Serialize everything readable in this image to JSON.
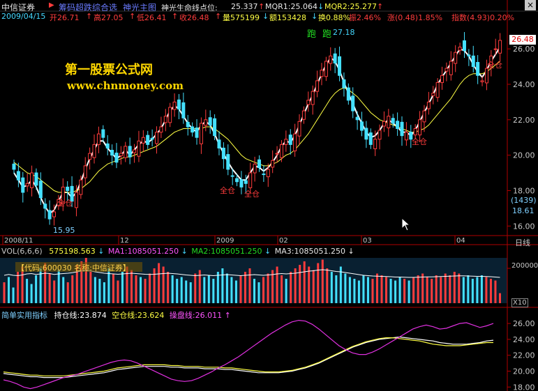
{
  "header": {
    "broker": "中信证券",
    "indicator_group": "筹码超跌综合选",
    "main_chart_name": "神光主图",
    "status_label": "神光生命线点位:",
    "status_value": "25.337",
    "mqr1": "MQR1:25.064",
    "mqr2": "MQR2:25.277",
    "arrow_up": "↑",
    "arrow_down": "↓",
    "close_glyph": "×"
  },
  "quote": {
    "date": "2009/04/15",
    "open": "开26.71",
    "high": "高27.05",
    "low": "低26.41",
    "close": "收26.48",
    "volume": "量575199",
    "amount": "额153428",
    "turnover": "换0.88%",
    "amplitude": "振2.46%",
    "change": "涨(0.48)1.85%",
    "index": "指数(4.93)0.20%"
  },
  "watermark": {
    "title": "第一股票公式网",
    "url": "www.chnmoney.com"
  },
  "annotations": {
    "run_label": "跑",
    "run_price": "27.18",
    "full_pos": "全仓",
    "low_price": "15.95",
    "price_tag": "26.48",
    "right_count": "(1439)",
    "right_price": "18.61",
    "period": "日线"
  },
  "vol_panel": {
    "title": "VOL(6,6,6)",
    "value": "575198.563",
    "ma1": "MA1:1085051.250",
    "ma2": "MA2:1085051.250",
    "ma3": "MA3:1085051.250",
    "badge": "【代码:600030 名称:中信证券】",
    "axis_label": "200000",
    "unit": "X10"
  },
  "indicator_panel": {
    "title": "简单实用指标",
    "hold_line": "持仓线:23.874",
    "empty_line": "空仓线:23.624",
    "operate_line": "操盘线:26.011"
  },
  "colors": {
    "up": "#ff3c3c",
    "down": "#44e0ff",
    "ma_yellow": "#ffff44",
    "line_white": "#ffffff",
    "line_magenta": "#e030e0",
    "axis": "#b00000",
    "background": "#000000"
  },
  "chart_data": [
    {
      "type": "candlestick",
      "title": "神光主图",
      "x_tick_labels": [
        "2008/11",
        "12",
        "2009",
        "02",
        "03",
        "04"
      ],
      "y_ticks": [
        16.0,
        18.0,
        20.0,
        22.0,
        24.0,
        26.0
      ],
      "ylim": [
        15.5,
        27.5
      ],
      "close": [
        19.2,
        18.6,
        17.9,
        18.4,
        19.0,
        18.3,
        17.6,
        17.0,
        16.4,
        16.8,
        17.5,
        18.2,
        18.0,
        17.4,
        17.9,
        18.6,
        19.4,
        20.1,
        20.6,
        21.2,
        21.0,
        20.4,
        20.0,
        19.6,
        20.1,
        20.5,
        19.9,
        20.3,
        20.8,
        21.0,
        20.6,
        20.9,
        21.3,
        21.6,
        22.2,
        22.7,
        23.0,
        22.6,
        22.1,
        21.6,
        21.3,
        21.0,
        21.8,
        22.0,
        21.7,
        21.1,
        20.4,
        19.8,
        19.2,
        18.8,
        18.5,
        18.2,
        18.4,
        19.0,
        19.5,
        19.3,
        18.9,
        19.2,
        19.7,
        20.1,
        20.6,
        20.9,
        20.6,
        21.2,
        21.9,
        22.5,
        23.1,
        23.6,
        24.2,
        24.8,
        25.3,
        25.6,
        25.2,
        24.5,
        23.8,
        23.1,
        22.5,
        22.0,
        21.4,
        20.9,
        20.6,
        20.9,
        21.4,
        21.9,
        22.2,
        21.8,
        21.5,
        21.1,
        21.3,
        20.9,
        21.5,
        22.0,
        22.5,
        23.0,
        23.5,
        24.1,
        24.5,
        24.9,
        25.3,
        25.8,
        26.1,
        25.9,
        25.6,
        25.0,
        24.5,
        24.2,
        24.9,
        25.6,
        26.0,
        26.48
      ],
      "series": [
        {
          "name": "",
          "color": "#ffffff",
          "values": [
            19.0,
            18.6,
            18.2,
            18.3,
            18.6,
            18.2,
            17.6,
            17.1,
            16.7,
            16.9,
            17.4,
            17.9,
            17.9,
            17.6,
            17.9,
            18.5,
            19.2,
            19.8,
            20.3,
            20.8,
            20.8,
            20.4,
            20.1,
            19.8,
            20.0,
            20.3,
            20.0,
            20.3,
            20.6,
            20.8,
            20.7,
            20.9,
            21.2,
            21.5,
            22.0,
            22.5,
            22.8,
            22.6,
            22.2,
            21.8,
            21.5,
            21.3,
            21.7,
            21.9,
            21.7,
            21.2,
            20.6,
            20.1,
            19.6,
            19.2,
            18.9,
            18.6,
            18.6,
            19.0,
            19.4,
            19.3,
            19.1,
            19.3,
            19.6,
            20.0,
            20.5,
            20.8,
            20.7,
            21.1,
            21.7,
            22.3,
            22.9,
            23.4,
            24.0,
            24.6,
            25.1,
            25.5,
            25.3,
            24.8,
            24.1,
            23.5,
            22.9,
            22.3,
            21.8,
            21.3,
            21.0,
            21.1,
            21.4,
            21.8,
            22.0,
            21.8,
            21.6,
            21.3,
            21.3,
            21.1,
            21.4,
            21.9,
            22.4,
            22.9,
            23.4,
            24.0,
            24.4,
            24.8,
            25.2,
            25.6,
            26.0,
            25.9,
            25.6,
            25.1,
            24.7,
            24.4,
            24.8,
            25.3,
            25.7,
            26.1
          ]
        },
        {
          "name": "",
          "color": "#ffff44",
          "values": [
            19.6,
            19.4,
            19.2,
            19.0,
            18.9,
            18.8,
            18.6,
            18.4,
            18.2,
            18.0,
            17.9,
            17.9,
            17.9,
            17.9,
            18.0,
            18.1,
            18.3,
            18.5,
            18.8,
            19.1,
            19.3,
            19.5,
            19.6,
            19.7,
            19.8,
            19.9,
            19.9,
            20.0,
            20.1,
            20.2,
            20.3,
            20.4,
            20.5,
            20.7,
            20.9,
            21.1,
            21.3,
            21.4,
            21.5,
            21.5,
            21.5,
            21.5,
            21.5,
            21.6,
            21.6,
            21.5,
            21.3,
            21.1,
            20.9,
            20.6,
            20.3,
            20.0,
            19.8,
            19.7,
            19.6,
            19.5,
            19.4,
            19.4,
            19.5,
            19.6,
            19.8,
            20.0,
            20.1,
            20.3,
            20.6,
            20.9,
            21.2,
            21.6,
            22.0,
            22.4,
            22.8,
            23.2,
            23.5,
            23.7,
            23.8,
            23.7,
            23.5,
            23.3,
            23.0,
            22.7,
            22.4,
            22.2,
            22.0,
            21.9,
            21.8,
            21.7,
            21.6,
            21.5,
            21.4,
            21.3,
            21.3,
            21.4,
            21.5,
            21.7,
            22.0,
            22.3,
            22.6,
            22.9,
            23.2,
            23.6,
            24.0,
            24.3,
            24.5,
            24.6,
            24.6,
            24.6,
            24.7,
            24.9,
            25.1,
            25.3
          ]
        }
      ],
      "annotations": [
        "跑 27.18",
        "全仓",
        "15.95"
      ]
    },
    {
      "type": "bar",
      "title": "VOL(6,6,6)",
      "y_ticks": [
        200000
      ],
      "unit": "X10",
      "values": [
        120000,
        150000,
        90000,
        180000,
        210000,
        140000,
        110000,
        160000,
        200000,
        230000,
        170000,
        130000,
        190000,
        150000,
        120000,
        160000,
        220000,
        240000,
        260000,
        180000,
        150000,
        140000,
        120000,
        200000,
        170000,
        130000,
        180000,
        210000,
        190000,
        160000,
        150000,
        140000,
        170000,
        200000,
        230000,
        210000,
        180000,
        160000,
        140000,
        150000,
        130000,
        120000,
        170000,
        190000,
        150000,
        160000,
        140000,
        180000,
        200000,
        170000,
        150000,
        130000,
        160000,
        180000,
        200000,
        140000,
        120000,
        150000,
        170000,
        190000,
        210000,
        160000,
        140000,
        180000,
        200000,
        220000,
        240000,
        210000,
        190000,
        230000,
        250000,
        200000,
        180000,
        160000,
        210000,
        170000,
        150000,
        140000,
        130000,
        160000,
        150000,
        140000,
        170000,
        160000,
        150000,
        140000,
        130000,
        150000,
        140000,
        130000,
        150000,
        160000,
        170000,
        150000,
        140000,
        160000,
        150000,
        170000,
        160000,
        180000,
        170000,
        150000,
        160000,
        140000,
        150000,
        160000,
        150000,
        140000,
        130000,
        57520
      ],
      "ma_line": [
        160000,
        165000,
        160000,
        158000,
        162000,
        168000,
        170000,
        165000,
        168000,
        172000,
        170000,
        165000,
        168000,
        170000,
        172000,
        175000,
        180000,
        185000,
        188000,
        185000,
        180000,
        176000,
        172000,
        170000,
        168000,
        166000,
        168000,
        170000,
        172000,
        170000,
        168000,
        166000,
        165000,
        166000,
        168000,
        170000,
        172000,
        170000,
        168000,
        165000,
        162000,
        160000,
        158000,
        160000,
        162000,
        160000,
        158000,
        160000,
        162000,
        164000,
        162000,
        160000,
        158000,
        160000,
        162000,
        164000,
        162000,
        160000,
        162000,
        164000,
        168000,
        170000,
        168000,
        170000,
        172000,
        176000,
        180000,
        184000,
        186000,
        190000,
        192000,
        190000,
        186000,
        182000,
        180000,
        176000,
        172000,
        168000,
        164000,
        160000,
        158000,
        156000,
        155000,
        154000,
        153000,
        152000,
        150000,
        150000,
        149000,
        148000,
        148000,
        149000,
        150000,
        151000,
        151000,
        152000,
        153000,
        154000,
        155000,
        156000,
        157000,
        157000,
        156000,
        155000,
        154000,
        154000,
        153000,
        152000,
        150000,
        148000
      ]
    },
    {
      "type": "line",
      "title": "简单实用指标",
      "y_ticks": [
        18.0,
        20.0,
        22.0,
        24.0,
        26.0
      ],
      "ylim": [
        17.5,
        26.8
      ],
      "series": [
        {
          "name": "持仓线",
          "color": "#ffffff",
          "values": [
            19.7,
            19.6,
            19.5,
            19.4,
            19.3,
            19.3,
            19.2,
            19.2,
            19.2,
            19.2,
            19.3,
            19.4,
            19.5,
            19.6,
            19.7,
            19.8,
            20.0,
            20.2,
            20.3,
            20.4,
            20.5,
            20.6,
            20.6,
            20.6,
            20.6,
            20.5,
            20.5,
            20.4,
            20.4,
            20.4,
            20.3,
            20.3,
            20.3,
            20.2,
            20.2,
            20.1,
            20.0,
            19.9,
            19.8,
            19.8,
            19.8,
            19.8,
            19.9,
            20.0,
            20.2,
            20.4,
            20.7,
            21.0,
            21.4,
            21.8,
            22.2,
            22.6,
            23.0,
            23.3,
            23.6,
            23.8,
            24.0,
            24.1,
            24.2,
            24.3,
            24.2,
            24.1,
            24.0,
            23.9,
            23.8,
            23.6,
            23.5,
            23.4,
            23.4,
            23.4,
            23.5,
            23.6,
            23.8,
            23.9
          ]
        },
        {
          "name": "空仓线",
          "color": "#ffff44",
          "values": [
            19.9,
            19.8,
            19.7,
            19.6,
            19.5,
            19.5,
            19.4,
            19.4,
            19.4,
            19.4,
            19.5,
            19.6,
            19.7,
            19.8,
            19.9,
            20.0,
            20.2,
            20.4,
            20.5,
            20.6,
            20.7,
            20.8,
            20.8,
            20.8,
            20.8,
            20.7,
            20.7,
            20.6,
            20.6,
            20.6,
            20.5,
            20.5,
            20.5,
            20.4,
            20.4,
            20.3,
            20.2,
            20.1,
            20.0,
            19.9,
            19.9,
            19.9,
            20.0,
            20.1,
            20.3,
            20.5,
            20.8,
            21.1,
            21.5,
            21.9,
            22.3,
            22.7,
            23.1,
            23.4,
            23.7,
            23.9,
            24.1,
            24.2,
            24.2,
            24.1,
            24.0,
            23.9,
            23.8,
            23.6,
            23.4,
            23.3,
            23.2,
            23.2,
            23.2,
            23.3,
            23.4,
            23.5,
            23.6,
            23.6
          ]
        },
        {
          "name": "操盘线",
          "color": "#e030e0",
          "values": [
            18.9,
            18.7,
            18.4,
            18.0,
            17.8,
            18.0,
            18.3,
            18.6,
            18.9,
            19.2,
            19.4,
            19.6,
            19.9,
            20.2,
            20.5,
            20.8,
            21.1,
            21.3,
            21.4,
            21.3,
            21.0,
            20.6,
            20.2,
            19.8,
            19.4,
            19.0,
            18.8,
            18.7,
            18.8,
            19.1,
            19.5,
            19.9,
            20.4,
            20.8,
            21.3,
            21.8,
            22.4,
            23.0,
            23.6,
            24.2,
            24.8,
            25.3,
            25.8,
            26.2,
            26.4,
            26.3,
            25.9,
            25.3,
            24.6,
            23.9,
            23.2,
            22.7,
            22.3,
            22.1,
            22.1,
            22.4,
            22.8,
            23.3,
            23.8,
            24.3,
            24.8,
            25.3,
            25.6,
            25.8,
            25.6,
            25.3,
            25.4,
            25.7,
            26.0,
            26.1,
            25.8,
            25.5,
            25.7,
            26.0
          ]
        }
      ]
    }
  ]
}
